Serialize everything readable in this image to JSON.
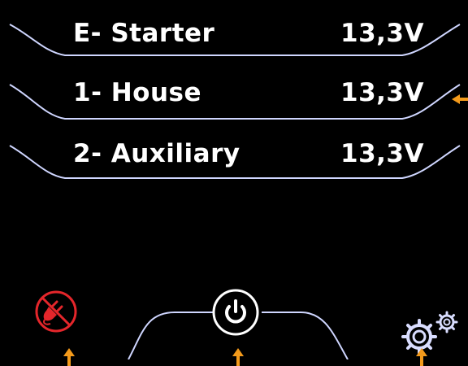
{
  "batteries": [
    {
      "name": "E- Starter",
      "voltage": "13,3V"
    },
    {
      "name": "1- House",
      "voltage": "13,3V"
    },
    {
      "name": "2- Auxiliary",
      "voltage": "13,3V"
    }
  ],
  "buttons": {
    "no_plug_icon": "no-shore-power-icon",
    "power_icon": "power-icon",
    "settings_icon": "settings-gears-icon"
  },
  "colors": {
    "background": "#000000",
    "text": "#ffffff",
    "frame_line": "#b9c7ff",
    "no_plug": "#e4262b",
    "annotation_arrow": "#f39a1b"
  }
}
